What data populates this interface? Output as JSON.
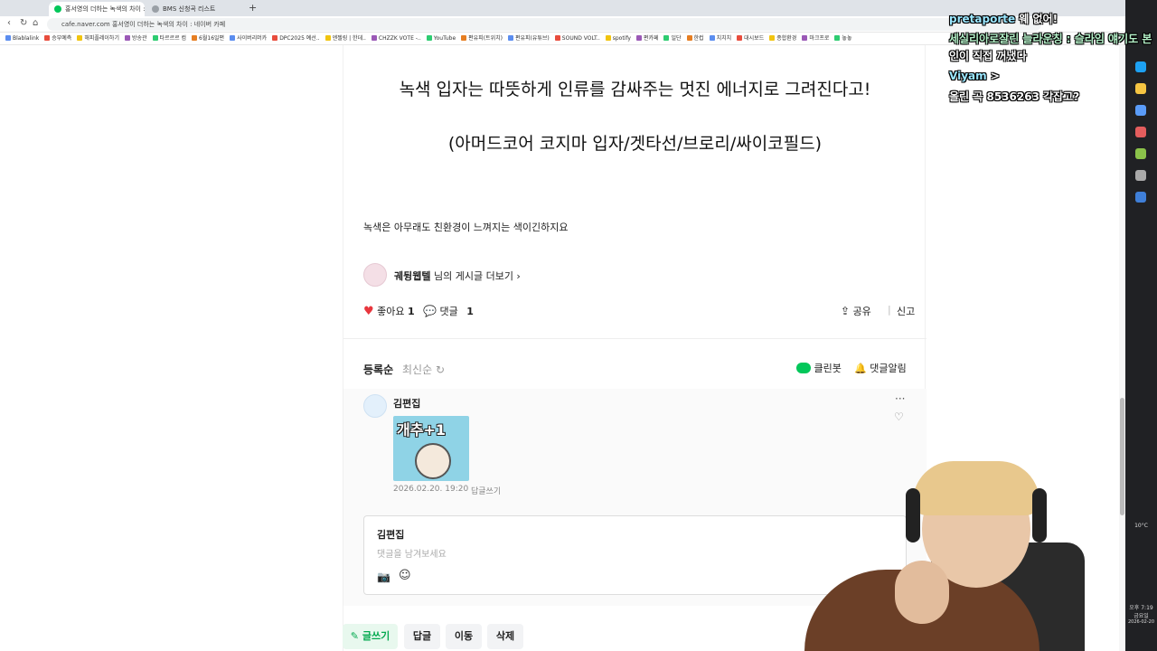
{
  "browser": {
    "tabs": [
      {
        "title": "홍서영의 더하는 녹색의 차이 : 네"
      },
      {
        "title": "BMS 신청곡 리스트"
      }
    ],
    "new_tab": "+",
    "url": "cafe.naver.com 홍서영이 더하는 녹색의 차이 : 네이버 카페",
    "bookmarks": [
      "Blablalink",
      "승부예측",
      "해피플레이하기",
      "방송관",
      "타르르르 컴",
      "6월16일편",
      "사이버리머카",
      "DPC2025 예선..",
      "엔젤링 | 한데..",
      "CHZZK VOTE -..",
      "YouTube",
      "편유피(트위치)",
      "편유피(유튜브)",
      "SOUND VOLT..",
      "spotify",
      "편카페",
      "일단",
      "한컵",
      "치치치",
      "대시보드",
      "종합환경",
      "마크프로",
      "놓놓"
    ]
  },
  "article": {
    "line1": "녹색 입자는 따뜻하게 인류를 감싸주는 멋진 에너지로 그려진다고!",
    "line2": "(아머드코어 코지마 입자/겟타선/브로리/싸이코필드)",
    "body": "녹색은 아무래도 친환경이 느껴지는 색이긴하지요",
    "author_name": "궤뒹웹텔",
    "author_more": "님의 게시글 더보기 ›",
    "like_label": "좋아요",
    "like_count": "1",
    "comment_label": "댓글",
    "comment_count": "1",
    "share_label": "공유",
    "report_label": "신고"
  },
  "comments": {
    "sort_registered": "등록순",
    "sort_latest": "최신순",
    "cleanbot_label": "클린봇",
    "notify_label": "댓글알림",
    "items": [
      {
        "author": "김편집",
        "sticker_text": "개추+1",
        "date": "2026.02.20. 19:20",
        "reply_label": "답글쓰기"
      }
    ],
    "editor_user": "김편집",
    "editor_placeholder": "댓글을 남겨보세요"
  },
  "actions": {
    "write": "글쓰기",
    "reply": "답글",
    "move": "이동",
    "delete": "삭제"
  },
  "chat": [
    {
      "name": "pretaporte",
      "message": "웨 없어!"
    },
    {
      "name": "",
      "message": "세실리아로잘린 늘라운칭 : 슬라임 얘기도 본"
    },
    {
      "name": "",
      "message": "인이 직접 꺼냈다"
    },
    {
      "name": "Viyam",
      "message": ">"
    },
    {
      "name": "",
      "message": "올린 곡 8536263 각잡고?"
    }
  ],
  "system": {
    "weather": "10°C",
    "time": "오후 7:19",
    "day": "금요일",
    "date": "2026-02-20"
  },
  "colors": {
    "like_heart": "#e8363d",
    "naver_green": "#03c75a",
    "sidepanel": "#202124"
  }
}
